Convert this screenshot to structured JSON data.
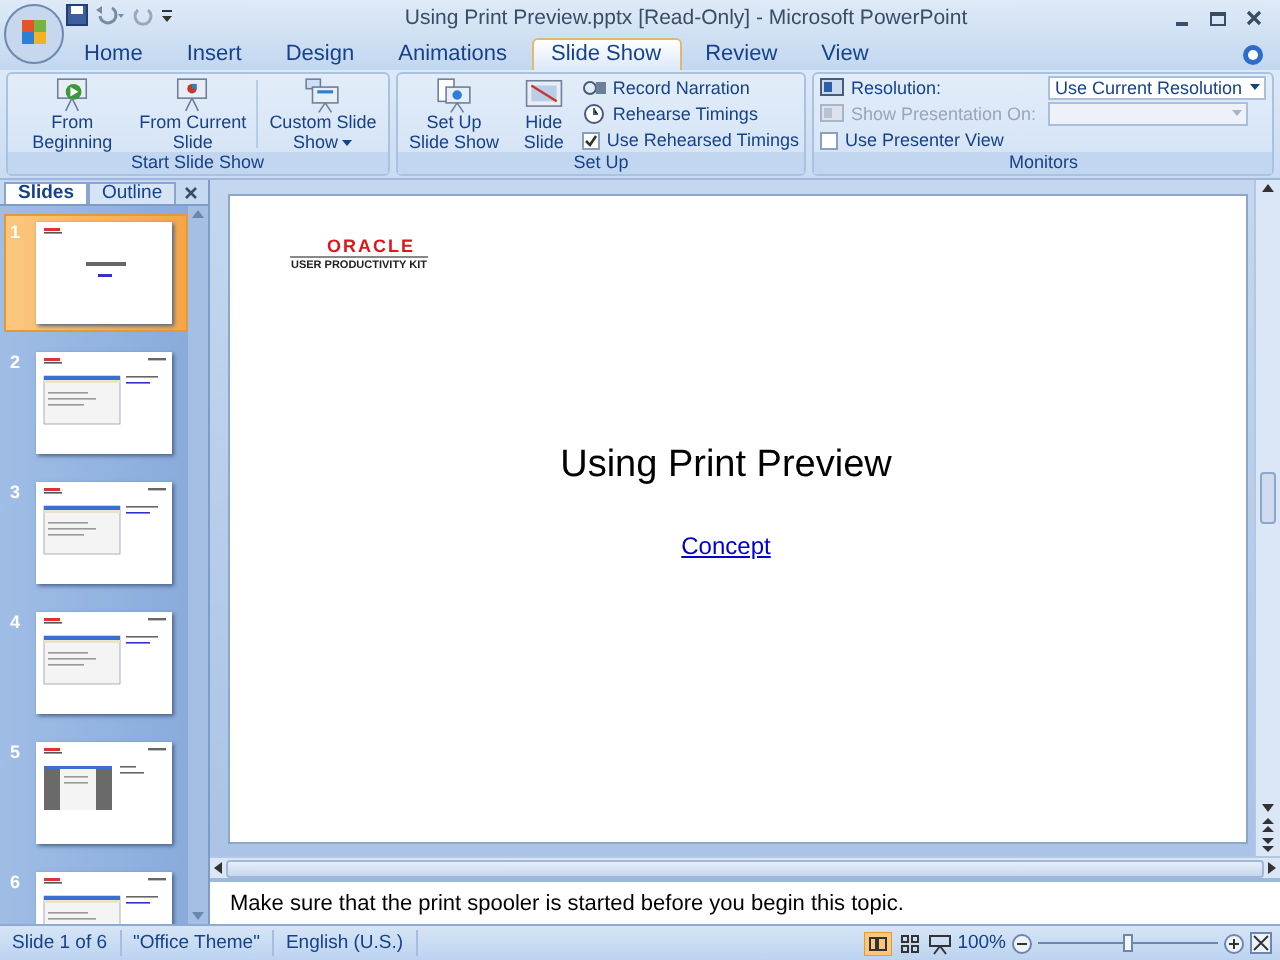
{
  "window": {
    "title": "Using Print Preview.pptx [Read-Only] - Microsoft PowerPoint"
  },
  "tabs": [
    {
      "label": "Home",
      "selected": false
    },
    {
      "label": "Insert",
      "selected": false
    },
    {
      "label": "Design",
      "selected": false
    },
    {
      "label": "Animations",
      "selected": false
    },
    {
      "label": "Slide Show",
      "selected": true
    },
    {
      "label": "Review",
      "selected": false
    },
    {
      "label": "View",
      "selected": false
    }
  ],
  "ribbon_groups": [
    {
      "label": "Start Slide Show",
      "items": [
        {
          "kind": "large",
          "label": "From Beginning"
        },
        {
          "kind": "large",
          "label": "From Current Slide"
        },
        {
          "kind": "large",
          "label": "Custom Slide Show",
          "dropdown": true
        }
      ]
    },
    {
      "label": "Set Up",
      "items": [
        {
          "kind": "large",
          "label": "Set Up Slide Show"
        },
        {
          "kind": "large",
          "label": "Hide Slide"
        },
        {
          "kind": "small",
          "label": "Record Narration"
        },
        {
          "kind": "small",
          "label": "Rehearse Timings"
        },
        {
          "kind": "check",
          "label": "Use Rehearsed Timings",
          "checked": true
        }
      ]
    },
    {
      "label": "Monitors",
      "items": [
        {
          "kind": "select",
          "label": "Resolution:",
          "value": "Use Current Resolution",
          "disabled": false
        },
        {
          "kind": "select",
          "label": "Show Presentation On:",
          "disabled": true
        },
        {
          "kind": "check",
          "label": "Use Presenter View",
          "checked": false
        }
      ]
    }
  ],
  "pane_tabs": [
    {
      "label": "Slides",
      "selected": true
    },
    {
      "label": "Outline",
      "selected": false
    }
  ],
  "slides": [
    {
      "number": "1",
      "selected": true,
      "kind": "title"
    },
    {
      "number": "2",
      "selected": false,
      "kind": "screen"
    },
    {
      "number": "3",
      "selected": false,
      "kind": "screen"
    },
    {
      "number": "4",
      "selected": false,
      "kind": "screen"
    },
    {
      "number": "5",
      "selected": false,
      "kind": "dark"
    },
    {
      "number": "6",
      "selected": false,
      "kind": "screen"
    }
  ],
  "slide": {
    "logo": "ORACLE",
    "logo_subtitle": "USER PRODUCTIVITY KIT",
    "title": "Using Print Preview",
    "link": "Concept"
  },
  "notes": "Make sure that the print spooler is started before you begin this topic.",
  "status_bar": {
    "slide": "Slide 1 of 6",
    "theme": "\"Office Theme\"",
    "language": "English (U.S.)",
    "zoom": "100%",
    "zoom_slider": {
      "level": 0.5
    }
  }
}
